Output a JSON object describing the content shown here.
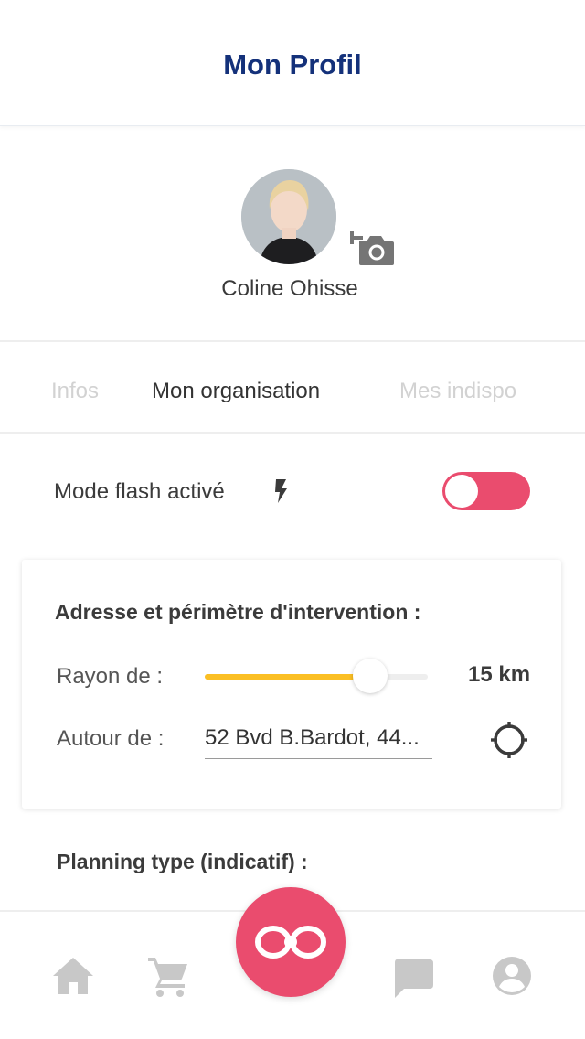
{
  "header": {
    "title": "Mon Profil"
  },
  "profile": {
    "name": "Coline Ohisse",
    "avatar_icon": "avatar-photo",
    "camera_icon": "add-photo-camera-icon"
  },
  "tabs": [
    {
      "label": "Infos",
      "active": false
    },
    {
      "label": "Mon organisation",
      "active": true
    },
    {
      "label": "Mes indispo",
      "active": false
    }
  ],
  "flash": {
    "label": "Mode flash activé",
    "icon": "flash-bolt-icon",
    "enabled": true
  },
  "intervention": {
    "title": "Adresse et périmètre d'intervention :",
    "radius_label": "Rayon de :",
    "radius_value": "15 km",
    "radius_fraction": 0.7,
    "around_label": "Autour de :",
    "address_value": "52 Bvd B.Bardot, 44...",
    "locate_icon": "gps-target-icon"
  },
  "planning": {
    "title": "Planning type (indicatif) :"
  },
  "bottom_nav": {
    "items": [
      "home-icon",
      "cart-icon",
      "center-infinity-icon",
      "chat-icon",
      "account-icon"
    ]
  },
  "colors": {
    "title_blue": "#14317a",
    "accent_pink": "#ea4c6e",
    "slider_yellow": "#fbbf24",
    "inactive_tab": "#d2d2d2",
    "icon_gray": "#c8c8c8"
  }
}
